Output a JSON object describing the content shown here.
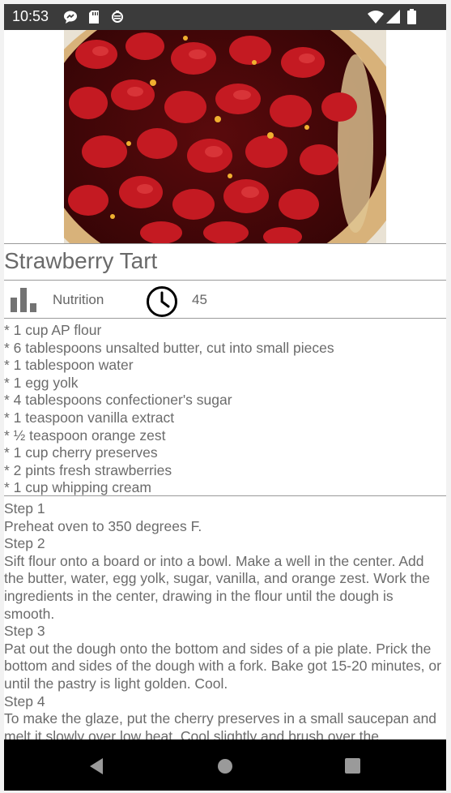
{
  "status_bar": {
    "time": "10:53"
  },
  "recipe": {
    "title": "Strawberry Tart",
    "nutrition_label": "Nutrition",
    "time_value": "45",
    "ingredients": [
      "* 1 cup AP flour",
      "* 6 tablespoons unsalted butter, cut into small pieces",
      "* 1 tablespoon water",
      "* 1 egg yolk",
      "* 4 tablespoons confectioner's sugar",
      "* 1 teaspoon vanilla extract",
      "* ½ teaspoon orange zest",
      "* 1 cup cherry preserves",
      "* 2 pints fresh strawberries",
      "* 1 cup whipping cream"
    ],
    "steps": [
      {
        "label": "Step 1",
        "text": "Preheat oven to 350 degrees F."
      },
      {
        "label": "Step 2",
        "text": "Sift flour onto a board or into a bowl. Make a well in the center. Add the butter, water, egg yolk, sugar, vanilla, and orange zest. Work the ingredients in the center, drawing in the flour until the dough is smooth."
      },
      {
        "label": "Step 3",
        "text": "Pat out the dough onto the bottom and sides of a pie plate. Prick the bottom and sides of the dough with a fork. Bake got 15-20 minutes, or until the pastry is light golden. Cool."
      },
      {
        "label": "Step 4",
        "text": "To make the glaze, put the cherry preserves in a small saucepan and melt it slowly over low heat. Cool slightly and brush over the"
      }
    ]
  },
  "icons": {
    "nutrition": "bar-chart-icon",
    "time": "clock-icon",
    "back": "back-icon",
    "home": "home-icon",
    "recents": "recents-icon"
  },
  "colors": {
    "status_bar_bg": "#3b3b3b",
    "nav_bar_bg": "#000000",
    "text": "#6b6b6b"
  }
}
